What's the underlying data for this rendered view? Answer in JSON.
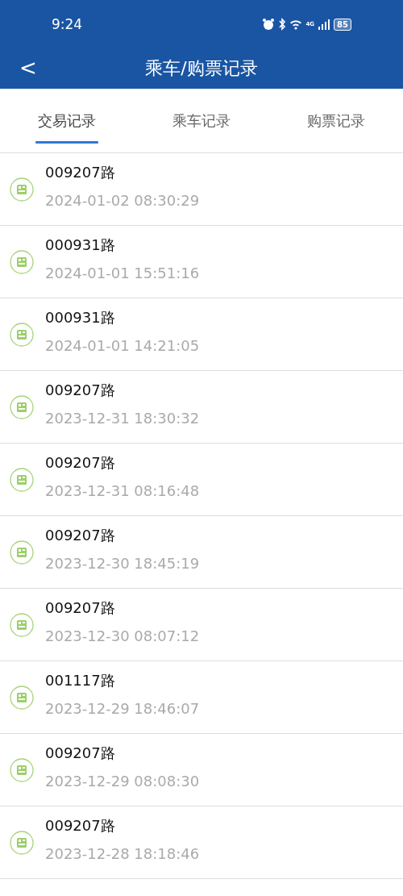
{
  "status_bar": {
    "time": "9:24",
    "network": "4G",
    "battery": "85"
  },
  "title_bar": {
    "back": "<",
    "title": "乘车/购票记录"
  },
  "tabs": [
    {
      "label": "交易记录",
      "selected": true
    },
    {
      "label": "乘车记录",
      "selected": false
    },
    {
      "label": "购票记录",
      "selected": false
    }
  ],
  "records": [
    {
      "route": "009207路",
      "time": "2024-01-02 08:30:29"
    },
    {
      "route": "000931路",
      "time": "2024-01-01 15:51:16"
    },
    {
      "route": "000931路",
      "time": "2024-01-01 14:21:05"
    },
    {
      "route": "009207路",
      "time": "2023-12-31 18:30:32"
    },
    {
      "route": "009207路",
      "time": "2023-12-31 08:16:48"
    },
    {
      "route": "009207路",
      "time": "2023-12-30 18:45:19"
    },
    {
      "route": "009207路",
      "time": "2023-12-30 08:07:12"
    },
    {
      "route": "001117路",
      "time": "2023-12-29 18:46:07"
    },
    {
      "route": "009207路",
      "time": "2023-12-29 08:08:30"
    },
    {
      "route": "009207路",
      "time": "2023-12-28 18:18:46"
    }
  ]
}
